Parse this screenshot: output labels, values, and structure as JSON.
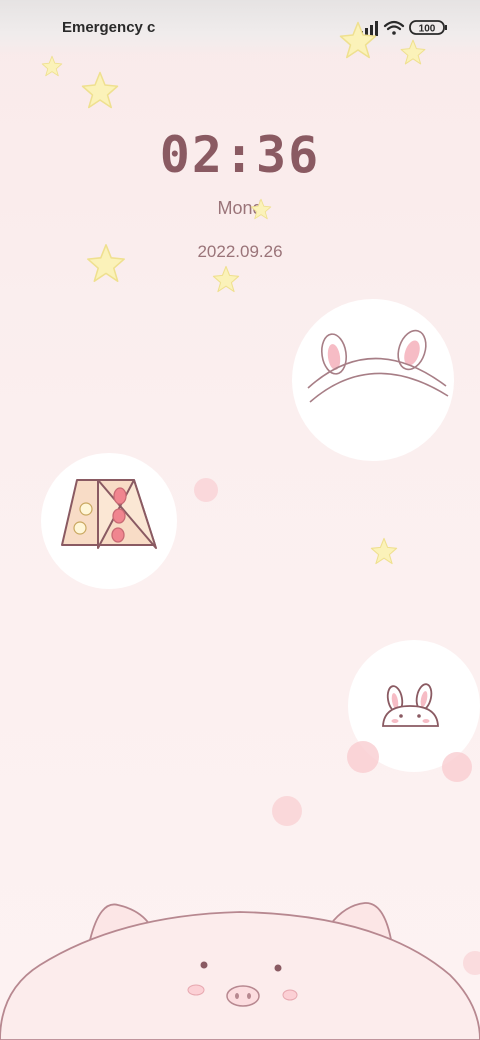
{
  "status_bar": {
    "carrier": "Emergency c",
    "battery": "100",
    "signal_icon": "signal-bars-icon",
    "wifi_icon": "wifi-icon",
    "battery_icon": "battery-icon"
  },
  "lock_screen": {
    "time": "02:36",
    "weekday": "Mond",
    "date": "2022.09.26"
  },
  "wallpaper": {
    "theme_colors": {
      "background": "#fbefef",
      "clock_text": "#8a5a62",
      "star": "#fbf2b9",
      "bubble": "#ffffff"
    },
    "decorations": [
      "star-icon",
      "bunny-ears-icon",
      "sandwich-icon",
      "bunny-face-icon",
      "pig-face-icon"
    ]
  }
}
